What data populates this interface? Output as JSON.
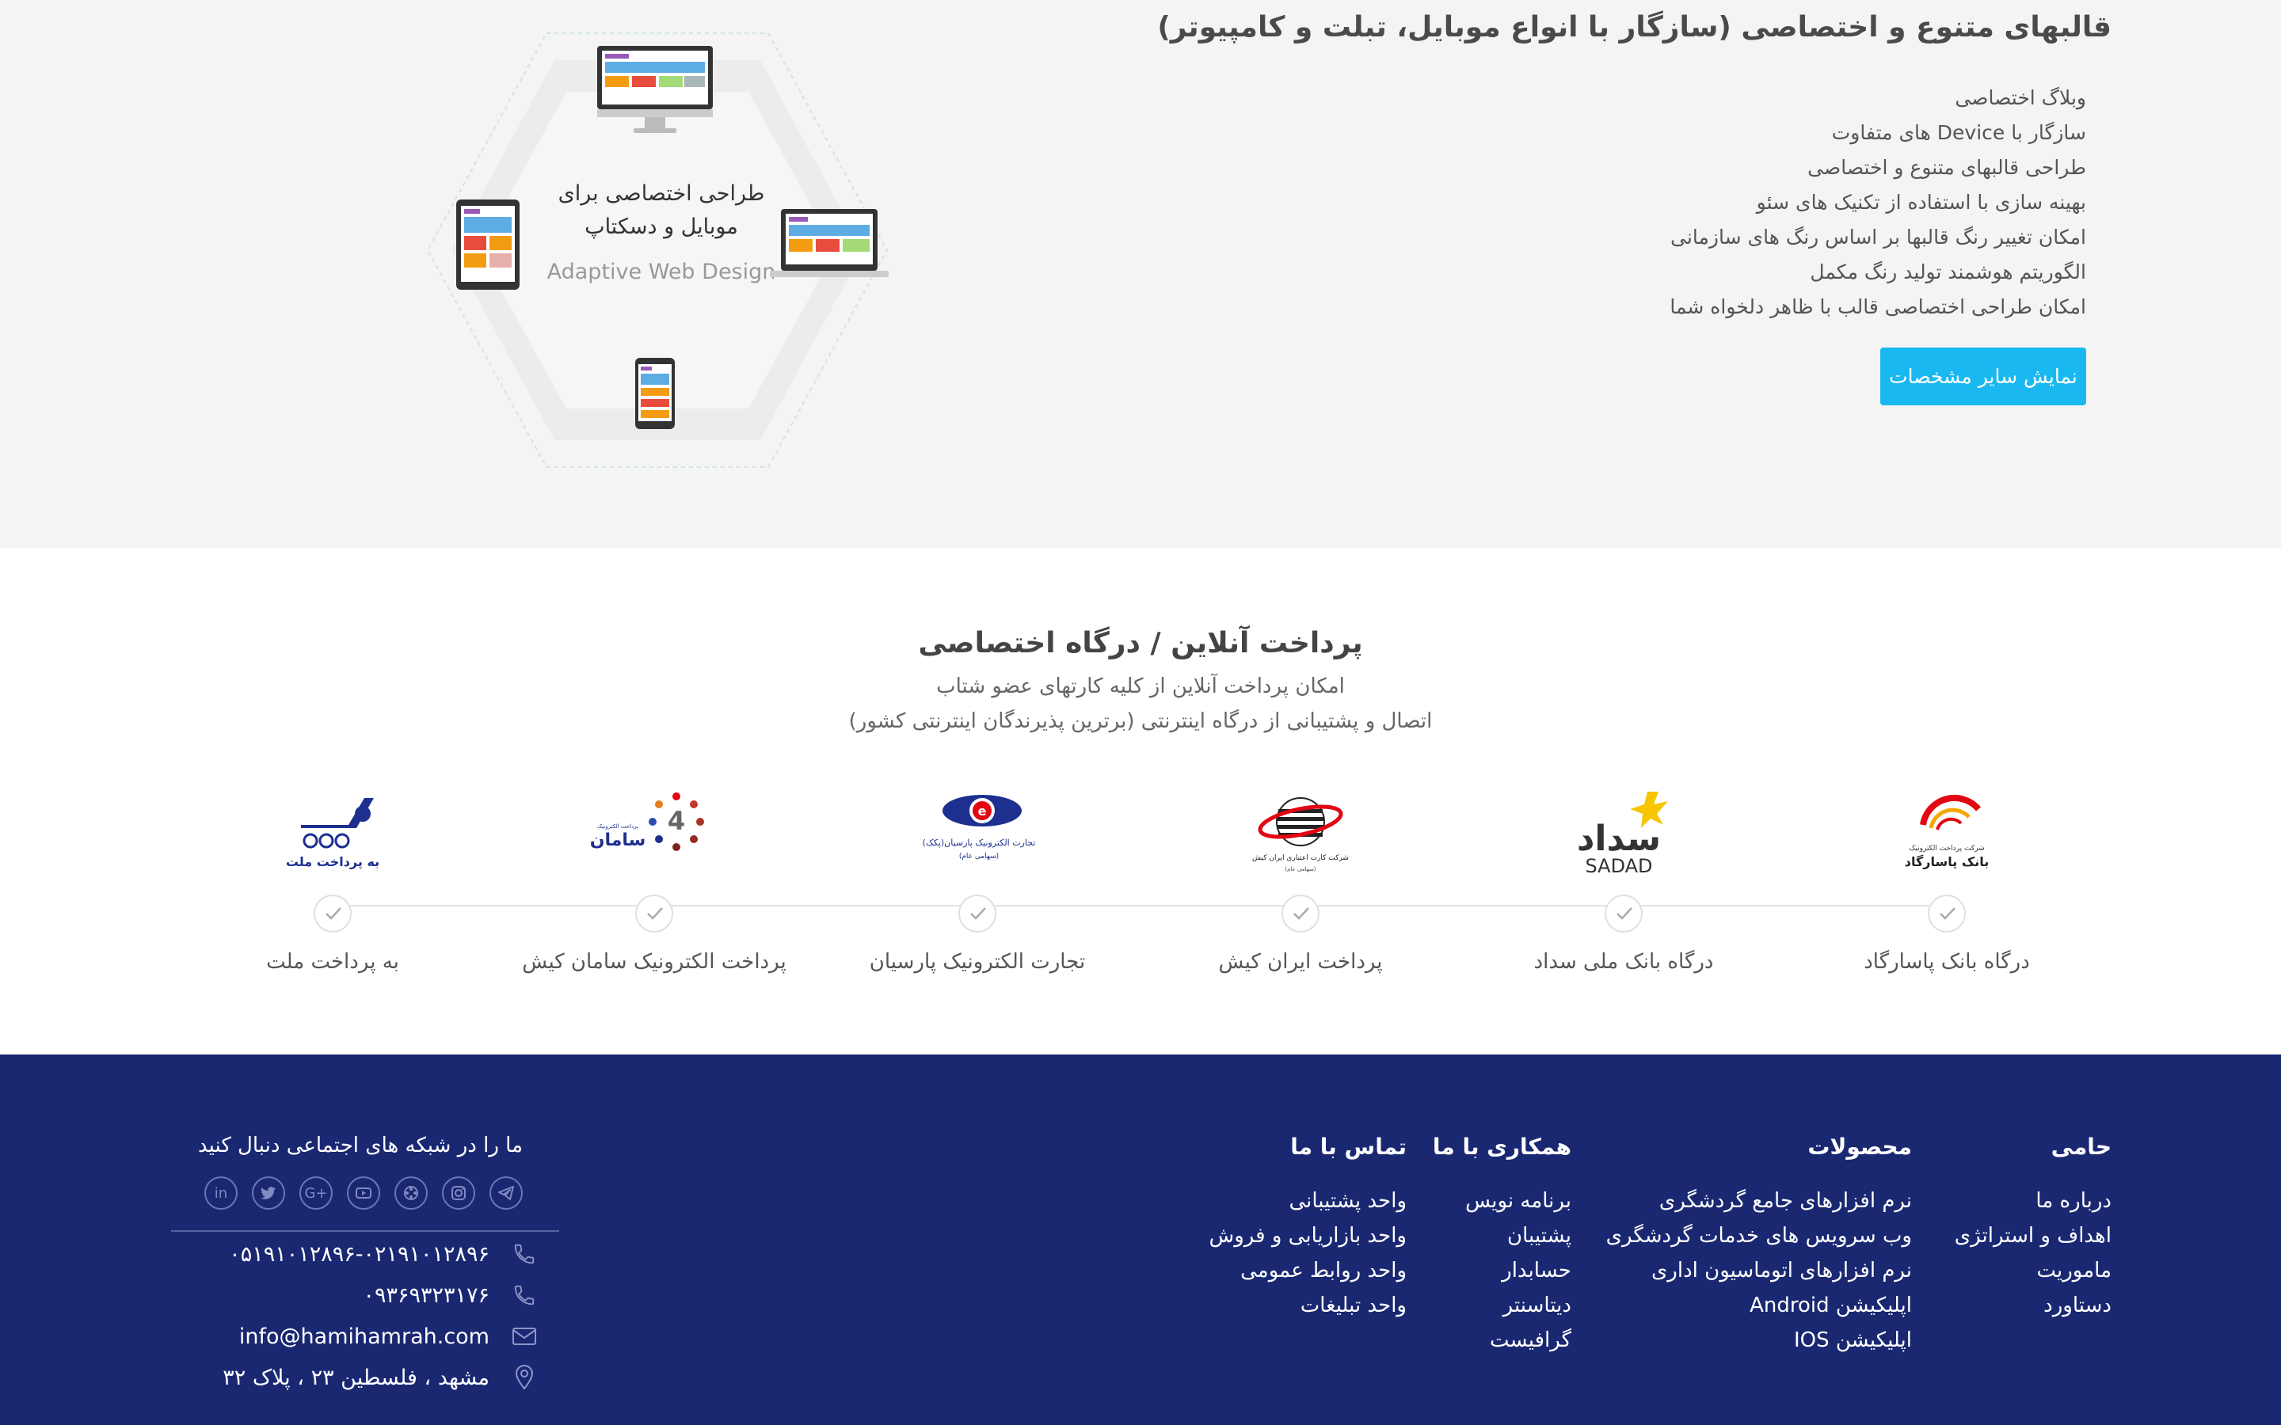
{
  "templates": {
    "title": "قالبهای متنوع و اختصاصی (سازگار با انواع موبایل، تبلت و کامپیوتر)",
    "features": [
      "وبلاگ اختصاصی",
      "سازگار با Device های متفاوت",
      "طراحی قالبهای متنوع و اختصاصی",
      "بهینه سازی با استفاده از تکنیک های سئو",
      "امکان تغییر رنگ قالبها بر اساس رنگ های سازمانی",
      "الگوریتم هوشمند تولید رنگ مکمل",
      "امکان طراحی اختصاصی قالب با ظاهر دلخواه شما"
    ],
    "button": "نمایش سایر مشخصات",
    "hex_text_fa": "طراحی اختصاصی برای موبایل و دسکتاپ",
    "hex_text_en": "Adaptive Web Design"
  },
  "payment": {
    "title": "پرداخت آنلاین / درگاه اختصاصی",
    "subtitle1": "امکان پرداخت آنلاین از کلیه کارتهای عضو شتاب",
    "subtitle2": "اتصال و پشتیبانی از درگاه اینترنتی (برترین پذیرندگان اینترنتی کشور)",
    "gateways": [
      {
        "name": "درگاه بانک پاسارگاد",
        "logo_text": "بانک پاسارگاد",
        "logo_sub": "شرکت پرداخت الکترونیک"
      },
      {
        "name": "درگاه بانک ملی سداد",
        "logo_text": "سداد",
        "logo_sub": "SADAD"
      },
      {
        "name": "پرداخت ایران کیش",
        "logo_text": "شرکت کارت اعتباری ایران کیش",
        "logo_sub": "(سهامی عام)"
      },
      {
        "name": "تجارت الکترونیک پارسیان",
        "logo_text": "تجارت الکترونیک پارسیان(پکک)",
        "logo_sub": "(سهامی عام)"
      },
      {
        "name": "پرداخت الکترونیک سامان کیش",
        "logo_text": "سامان",
        "logo_sub": "پرداخت الکترونیک"
      },
      {
        "name": "به پرداخت ملت",
        "logo_text": "به پرداخت ملت",
        "logo_sub": ""
      }
    ]
  },
  "footer": {
    "col_hami": {
      "title": "حامی",
      "items": [
        "درباره ما",
        "اهداف و استراتژی",
        "ماموریت",
        "دستاورد"
      ]
    },
    "col_products": {
      "title": "محصولات",
      "items": [
        "نرم افزارهای جامع گردشگری",
        "وب سرویس های خدمات گردشگری",
        "نرم افزارهای اتوماسیون اداری",
        "اپلیکیشن Android",
        "اپلیکیشن IOS"
      ]
    },
    "col_coop": {
      "title": "همکاری با ما",
      "items": [
        "برنامه نویس",
        "پشتیبان",
        "حسابدار",
        "دیتاسنتر",
        "گرافیست"
      ]
    },
    "col_contact": {
      "title": "تماس با ما",
      "items": [
        "واحد پشتیبانی",
        "واحد بازاریابی و فروش",
        "واحد روابط عمومی",
        "واحد تبلیغات"
      ]
    },
    "social_title": "ما را در شبکه های اجتماعی دنبال کنید",
    "social_icons": [
      "telegram-icon",
      "instagram-icon",
      "aparat-icon",
      "youtube-icon",
      "google-plus-icon",
      "twitter-icon",
      "linkedin-icon"
    ],
    "phone1": "۰۵۱۹۱۰۱۲۸۹۶-۰۲۱۹۱۰۱۲۸۹۶",
    "phone2": "۰۹۳۶۹۳۲۳۱۷۶",
    "email": "info@hamihamrah.com",
    "address": "مشهد ، فلسطین ۲۳ ، پلاک ۳۲"
  },
  "colors": {
    "accent": "#1ab8f0",
    "footer_bg": "#1a2872",
    "section_bg": "#f4f4f4"
  }
}
